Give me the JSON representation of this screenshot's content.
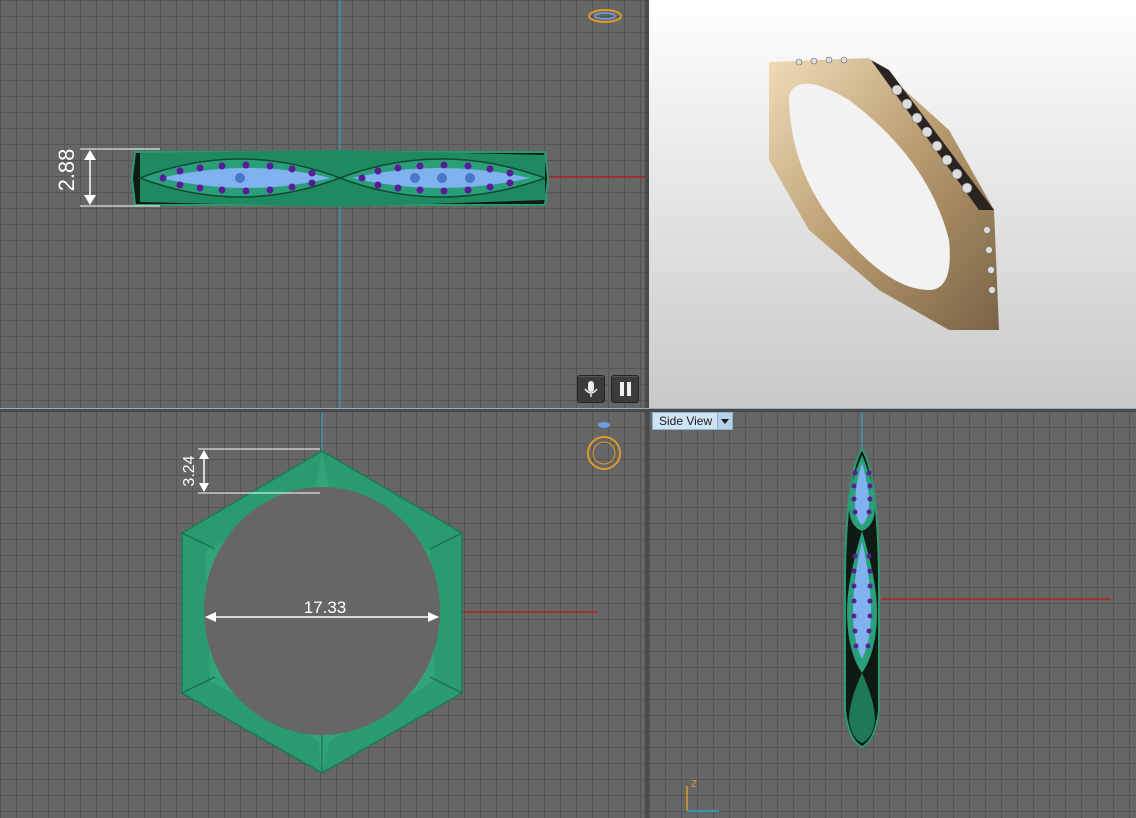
{
  "viewports": {
    "top_left": {
      "dimension_height": "2.88"
    },
    "top_right": {},
    "bottom_left": {
      "dimension_top": "3.24",
      "dimension_diameter": "17.33"
    },
    "bottom_right": {
      "view_label": "Side View",
      "axis_label": "Z"
    }
  },
  "colors": {
    "grid_bg": "#666666",
    "grid_line": "#555555",
    "ring_green": "#2a9a6f",
    "gem_blue": "#7fb2ee",
    "gem_purple": "#5a1a9a",
    "gold": "#c9b18c",
    "axis_red": "#b02020",
    "axis_cyan": "#2aa8c8",
    "gizmo_orange": "#e09a2c"
  },
  "icons": [
    "microphone-icon",
    "pause-icon",
    "ring-gizmo-icon",
    "dropdown-arrow-icon"
  ]
}
